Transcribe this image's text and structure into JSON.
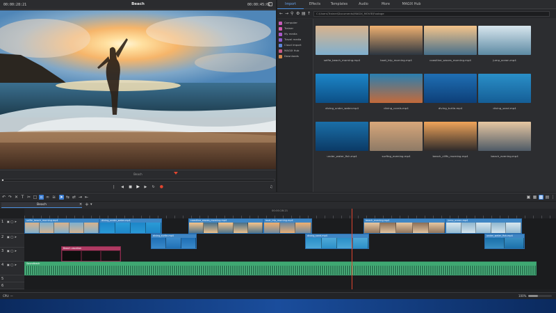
{
  "preview": {
    "title": "Beach",
    "timecode_left": "00:00:28:21",
    "timecode_right": "00:00:45:02",
    "scrub_label": "Beach",
    "duration_label": "H"
  },
  "media": {
    "tabs": [
      "Import",
      "Effects",
      "Templates",
      "Audio",
      "More",
      "MAGIX Hub"
    ],
    "active_tab": "Import",
    "path": "C:\\Users\\Trainer\\Documents\\MAGIX_MOVIE\\Footage",
    "sidebar": [
      {
        "label": "Computer",
        "color": "#c45bb8"
      },
      {
        "label": "Trainer",
        "color": "#d45bb0"
      },
      {
        "label": "My media",
        "color": "#a958c9"
      },
      {
        "label": "Travel media",
        "color": "#8d5bd1"
      },
      {
        "label": "Cloud import",
        "color": "#5b86d8"
      },
      {
        "label": "MAGIX Hub",
        "color": "#c45b8a"
      },
      {
        "label": "Downloads",
        "color": "#d4884a"
      }
    ],
    "files": [
      {
        "name": "selfie_beach_morning.mp4",
        "colors": [
          "#d9b38c",
          "#7fb0cf"
        ]
      },
      {
        "name": "boat_trip_morning.mp4",
        "colors": [
          "#f0b070",
          "#2d3640"
        ]
      },
      {
        "name": "coastline_waves_morning.mp4",
        "colors": [
          "#f5c48a",
          "#466f8a"
        ]
      },
      {
        "name": "jump_ocean.mp4",
        "colors": [
          "#d8e6ee",
          "#5d8aa3"
        ]
      },
      {
        "name": "diving_under_water.mp4",
        "colors": [
          "#1d86c8",
          "#0c4f86"
        ]
      },
      {
        "name": "diving_corals.mp4",
        "colors": [
          "#2a7fb0",
          "#c46a3a"
        ]
      },
      {
        "name": "diving_turtle.mp4",
        "colors": [
          "#1f6fb4",
          "#0d3f78"
        ]
      },
      {
        "name": "diving_sand.mp4",
        "colors": [
          "#2a8fc8",
          "#155e96"
        ]
      },
      {
        "name": "under_water_fish.mp4",
        "colors": [
          "#1a6fa8",
          "#0b3a66"
        ]
      },
      {
        "name": "surfing_evening.mp4",
        "colors": [
          "#d8a77a",
          "#8e7a66"
        ]
      },
      {
        "name": "beach_cliffs_morning.mp4",
        "colors": [
          "#f0a45a",
          "#2e2a2a"
        ]
      },
      {
        "name": "beach_evening.mp4",
        "colors": [
          "#e7c7a2",
          "#4e5a66"
        ]
      }
    ]
  },
  "timeline": {
    "project_tab": "Beach",
    "ruler_mark": "00:00:28:21",
    "zoom": "100%",
    "status": "CPU: —",
    "track_numbers": [
      "1",
      "2",
      "3",
      "4",
      "5",
      "6"
    ],
    "clips_track1": [
      {
        "label": "selfie_beach_morning.mp4",
        "colors": [
          "#d9b38c",
          "#7fb0cf"
        ]
      },
      {
        "label": "diving_under_water.mp4",
        "colors": [
          "#1d86c8",
          "#2a9ad6"
        ]
      },
      {
        "label": "coastline_waves_morning.mp4",
        "colors": [
          "#f5c48a",
          "#466f8a"
        ]
      },
      {
        "label": "boat_trip_morning.mp4",
        "colors": [
          "#f0b070",
          "#6a87a0"
        ]
      },
      {
        "label": "beach_evening.mp4",
        "colors": [
          "#e7c7a2",
          "#8a6f58"
        ]
      },
      {
        "label": "jump_ocean.mp4",
        "colors": [
          "#d8e6ee",
          "#8fb7cf"
        ]
      }
    ],
    "clips_track2": [
      {
        "label": "diving_turtle.mp4",
        "colors": [
          "#1f6fb4",
          "#3b8bcc"
        ]
      },
      {
        "label": "diving_sand.mp4",
        "colors": [
          "#2a8fc8",
          "#4ea8d8"
        ]
      },
      {
        "label": "under_water_fish.mp4",
        "colors": [
          "#1a6fa8",
          "#3a8fc3"
        ]
      }
    ],
    "title_clip": "Beach vacation",
    "audio_clip": "Soundtrack"
  }
}
